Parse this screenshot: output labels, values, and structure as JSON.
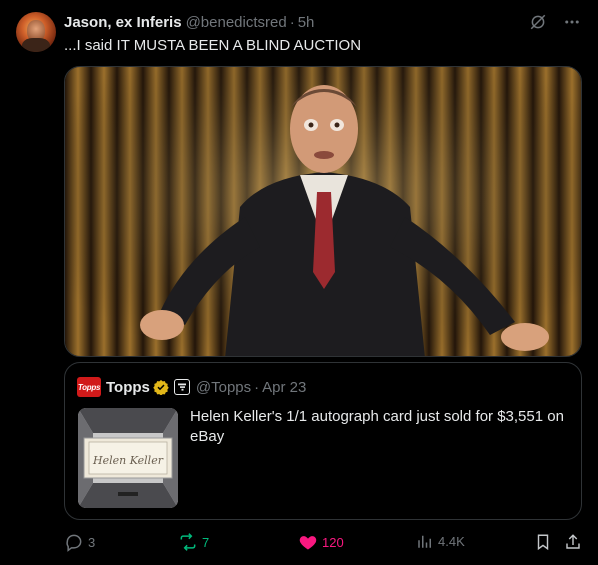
{
  "author": {
    "name": "Jason, ex Inferis",
    "handle": "@benedictsred",
    "separator": "·",
    "time": "5h"
  },
  "tweet": {
    "text": "...I said IT MUSTA BEEN A BLIND AUCTION"
  },
  "media": {
    "description_icon": "comedian-on-stage-image"
  },
  "quote": {
    "logo_text": "Topps",
    "name": "Topps",
    "handle": "@Topps",
    "separator": "·",
    "time": "Apr 23",
    "text": "Helen Keller's 1/1 autograph card just sold for $3,551 on eBay",
    "card_signature": "Helen Keller"
  },
  "actions": {
    "replies": "3",
    "reposts": "7",
    "likes": "120",
    "views": "4.4K"
  },
  "colors": {
    "background": "#000000",
    "text": "#e7e9ea",
    "muted": "#71767b",
    "repost": "#00ba7c",
    "like": "#f91880",
    "border": "#2f3336",
    "brand_red": "#d11a1a"
  }
}
